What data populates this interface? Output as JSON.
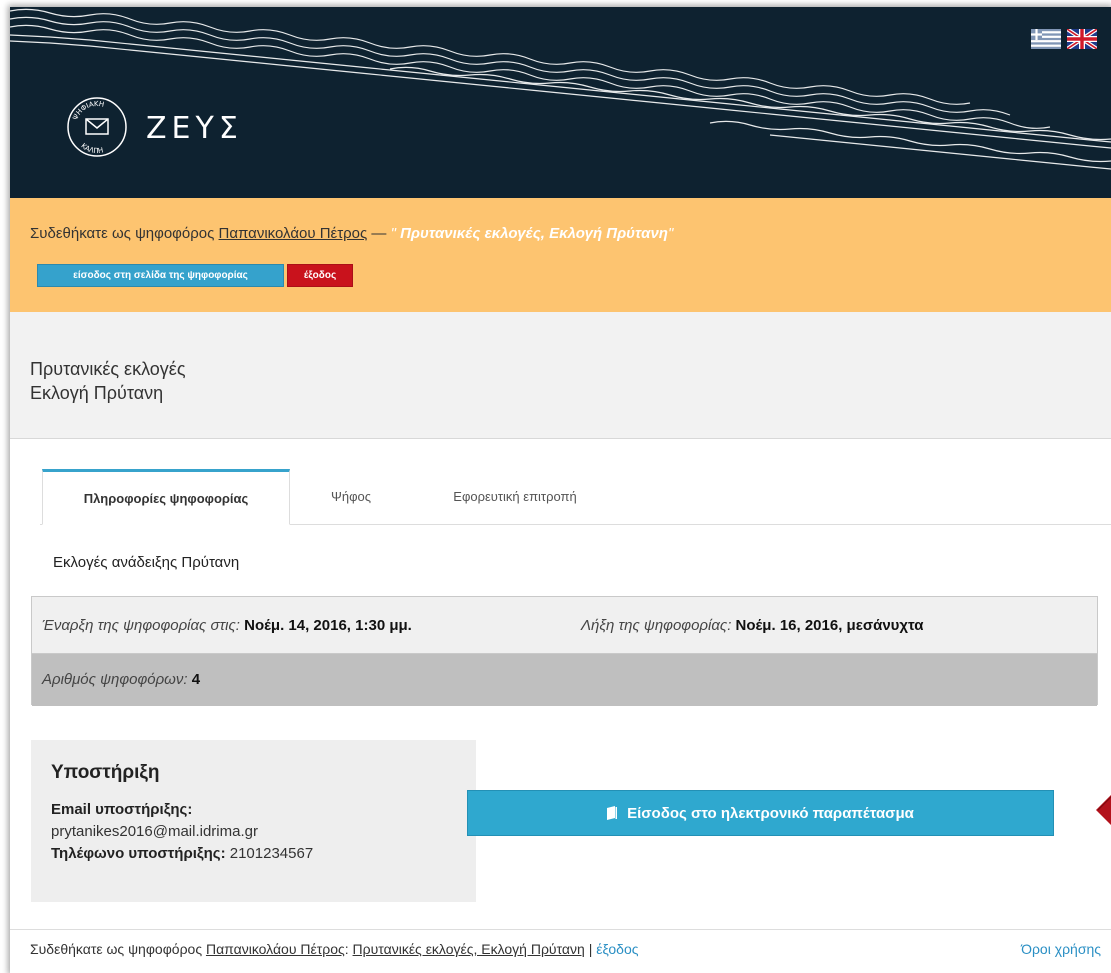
{
  "header": {
    "logo_text": "ΖΕΥΣ",
    "logo_ring_top": "ΨΗΦΙΑΚΗ",
    "logo_ring_bottom": "ΚΑΛΠΗ",
    "flags": [
      "greek-flag",
      "uk-flag"
    ]
  },
  "notice": {
    "prefix": "Συδεθήκατε ως ψηφοφόρος ",
    "voter_name": "Παπανικολάου Πέτρος",
    "dash": " — ",
    "quote_open": "\" ",
    "election_title": "Πρυτανικές εκλογές, Εκλογή Πρύτανη",
    "quote_close": "\"",
    "enter_button": "είσοδος στη σελίδα της ψηφοφορίας",
    "exit_button": "έξοδος"
  },
  "election": {
    "title_line1": "Πρυτανικές εκλογές",
    "title_line2": "Εκλογή Πρύτανη"
  },
  "tabs": [
    "Πληροφορίες ψηφοφορίας",
    "Ψήφος",
    "Εφορευτική επιτροπή"
  ],
  "description": "Εκλογές ανάδειξης Πρύτανη",
  "info": {
    "start_label": "Έναρξη της ψηφοφορίας στις:",
    "start_value": "Νοέμ. 14, 2016, 1:30 μμ.",
    "end_label": "Λήξη της ψηφοφορίας:",
    "end_value": "Νοέμ. 16, 2016, μεσάνυχτα",
    "voters_label": "Αριθμός ψηφοφόρων:",
    "voters_value": "4"
  },
  "support": {
    "heading": "Υποστήριξη",
    "email_label": "Email υποστήριξης:",
    "email": "prytanikes2016@mail.idrima.gr",
    "phone_label": "Τηλέφωνο υποστήριξης:",
    "phone": "2101234567"
  },
  "booth_button": "Είσοδος στο ηλεκτρονικό παραπέτασμα",
  "footer": {
    "prefix": "Συδεθήκατε ως ψηφοφόρος ",
    "voter_name": "Παπανικολάου Πέτρος",
    "colon": ": ",
    "election_title": "Πρυτανικές εκλογές, Εκλογή Πρύτανη",
    "separator": " | ",
    "logout": "έξοδος",
    "terms": "Όροι χρήσης"
  },
  "colors": {
    "header_bg": "#0e2230",
    "notice_bg": "#fdc470",
    "accent_blue": "#2fa8cf",
    "exit_red": "#c9121c",
    "pointer_red": "#b3121c"
  }
}
